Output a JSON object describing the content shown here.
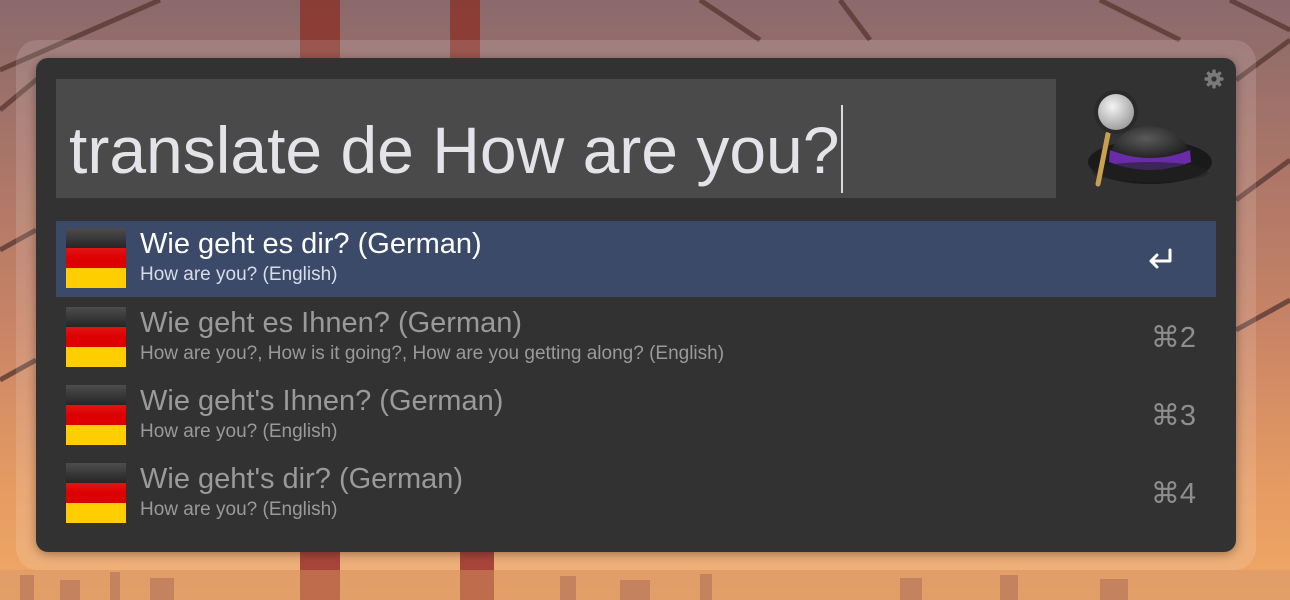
{
  "query": {
    "text": "translate de How are you?"
  },
  "icons": {
    "settings": "gear-icon",
    "app_logo": "alfred-hat-icon",
    "result_icon": "german-flag-icon",
    "action": "return-key-icon"
  },
  "colors": {
    "window_bg": "#323232",
    "search_bg": "#4a4a4a",
    "selected_row": "#3c4a6a",
    "flag_black": "#111111",
    "flag_red": "#dd0000",
    "flag_gold": "#ffce00",
    "hat_band": "#6a2ba8"
  },
  "results": [
    {
      "title": "Wie geht es dir? (German)",
      "subtitle": "How are you? (English)",
      "shortcut": "",
      "selected": true
    },
    {
      "title": "Wie geht es Ihnen? (German)",
      "subtitle": "How are you?, How is it going?, How are you getting along? (English)",
      "shortcut": "⌘2",
      "selected": false
    },
    {
      "title": "Wie geht's Ihnen? (German)",
      "subtitle": "How are you? (English)",
      "shortcut": "⌘3",
      "selected": false
    },
    {
      "title": "Wie geht's dir? (German)",
      "subtitle": "How are you? (English)",
      "shortcut": "⌘4",
      "selected": false
    }
  ]
}
